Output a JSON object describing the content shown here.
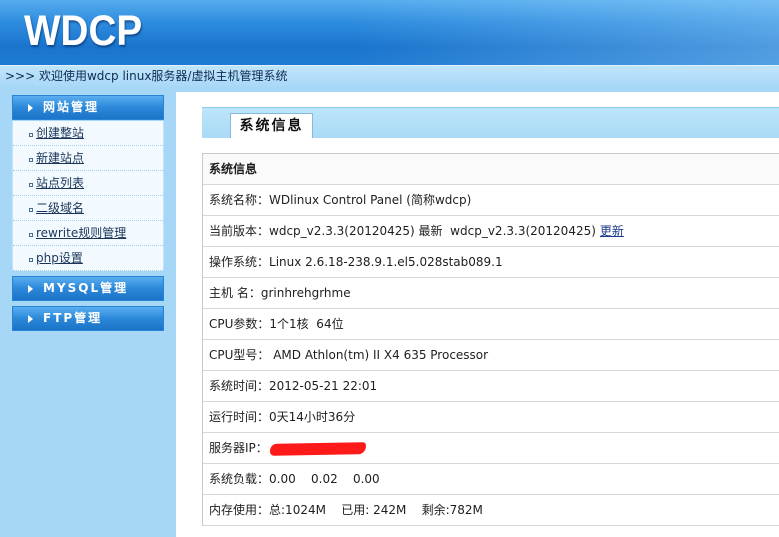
{
  "header": {
    "logo": "WDCP"
  },
  "welcome": {
    "text": ">>> 欢迎使用wdcp linux服务器/虚拟主机管理系统"
  },
  "sidebar": {
    "groups": [
      {
        "title": "网站管理",
        "items": [
          "创建整站",
          "新建站点",
          "站点列表",
          "二级域名",
          "rewrite规则管理",
          "php设置"
        ]
      },
      {
        "title": "MYSQL管理"
      },
      {
        "title": "FTP管理"
      }
    ]
  },
  "content": {
    "tab": "系统信息",
    "table_title": "系统信息",
    "rows": [
      {
        "label": "系统名称：",
        "value": "WDlinux Control Panel (简称wdcp)"
      },
      {
        "label": "当前版本：",
        "value": "wdcp_v2.3.3(20120425) 最新  wdcp_v2.3.3(20120425)",
        "link": "更新"
      },
      {
        "label": "操作系统：",
        "value": "Linux 2.6.18-238.9.1.el5.028stab089.1"
      },
      {
        "label": "主机 名：",
        "value": "grinhrehgrhme"
      },
      {
        "label": "CPU参数：",
        "value": "1个1核  64位"
      },
      {
        "label": "CPU型号：",
        "value": " AMD Athlon(tm) II X4 635 Processor"
      },
      {
        "label": "系统时间：",
        "value": "2012-05-21 22:01"
      },
      {
        "label": "运行时间：",
        "value": "0天14小时36分"
      },
      {
        "label": "服务器IP："
      },
      {
        "label": "系统负载：",
        "value": "0.00    0.02    0.00"
      },
      {
        "label": "内存使用：",
        "value": "总:1024M    已用: 242M    剩余:782M"
      }
    ]
  },
  "icons": {
    "group_arrow": "arrow-right-icon",
    "item_bullet": "bullet-icon"
  },
  "colors": {
    "header_blue": "#1f7bd2",
    "sidebar_bg": "#a6d7f6",
    "menu_head": "#2584d6",
    "redaction": "#ff1a1a",
    "link": "#1a3a8a"
  }
}
